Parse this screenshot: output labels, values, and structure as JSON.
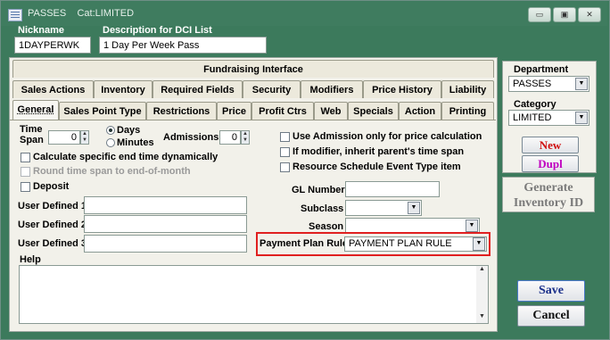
{
  "window": {
    "title": "PASSES",
    "subtitle": "Cat:LIMITED",
    "btn_min": "▭",
    "btn_max": "▣",
    "btn_close": "✕"
  },
  "header": {
    "nickname_label": "Nickname",
    "nickname_value": "1DAYPERWK",
    "description_label": "Description for DCI List",
    "description_value": "1 Day Per Week Pass"
  },
  "tabs": {
    "row1": [
      "Fundraising Interface"
    ],
    "row2": [
      "Sales Actions",
      "Inventory",
      "Required Fields",
      "Security",
      "Modifiers",
      "Price History",
      "Liability"
    ],
    "row3": [
      "General",
      "Sales Point Type",
      "Restrictions",
      "Price",
      "Profit Ctrs",
      "Web",
      "Specials",
      "Action",
      "Printing"
    ],
    "active": "General"
  },
  "general": {
    "time_span_label": "Time Span",
    "time_span_value": "0",
    "days_label": "Days",
    "minutes_label": "Minutes",
    "admissions_label": "Admissions",
    "admissions_value": "0",
    "calc_end_time_label": "Calculate specific end time dynamically",
    "round_time_span_label": "Round time span to end-of-month",
    "deposit_label": "Deposit",
    "admission_only_label": "Use Admission only for price calculation",
    "inherit_parent_label": "If modifier, inherit parent's time span",
    "resource_schedule_label": "Resource Schedule Event Type item",
    "user_defined_1_label": "User Defined 1",
    "user_defined_2_label": "User Defined 2",
    "user_defined_3_label": "User Defined 3",
    "gl_number_label": "GL Number",
    "subclass_label": "Subclass",
    "season_label": "Season",
    "payment_plan_label": "Payment Plan Rule",
    "payment_plan_value": "PAYMENT PLAN RULE",
    "help_label": "Help"
  },
  "side": {
    "department_label": "Department",
    "department_value": "PASSES",
    "category_label": "Category",
    "category_value": "LIMITED",
    "new_label": "New",
    "dupl_label": "Dupl",
    "generate_label": "Generate Inventory ID",
    "save_label": "Save",
    "cancel_label": "Cancel"
  },
  "colors": {
    "window_bg": "#3c7a5c",
    "highlight_border": "#e02020",
    "new_text": "#d01010",
    "dupl_text": "#c000c0",
    "save_text": "#1a2f8a"
  }
}
